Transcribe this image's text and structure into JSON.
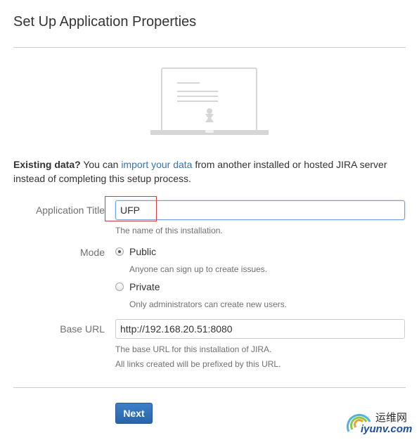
{
  "page": {
    "title": "Set Up Application Properties"
  },
  "existing_data": {
    "bold": "Existing data?",
    "text1": " You can ",
    "link": "import your data",
    "text2": " from another installed or hosted JIRA server instead of completing this setup process."
  },
  "form": {
    "app_title": {
      "label": "Application Title",
      "value": "UFP",
      "description": "The name of this installation."
    },
    "mode": {
      "label": "Mode",
      "options": [
        {
          "label": "Public",
          "description": "Anyone can sign up to create issues.",
          "selected": true
        },
        {
          "label": "Private",
          "description": "Only administrators can create new users.",
          "selected": false
        }
      ]
    },
    "base_url": {
      "label": "Base URL",
      "value": "http://192.168.20.51:8080",
      "description1": "The base URL for this installation of JIRA.",
      "description2": "All links created will be prefixed by this URL."
    }
  },
  "actions": {
    "next_label": "Next"
  },
  "watermark": {
    "cn": "运维网",
    "en": "iyunv.com"
  },
  "colors": {
    "link": "#3b73af",
    "primary_button": "#2d6cb5",
    "highlight": "#d23c3c"
  },
  "icons": {
    "illustration": "laptop-setup-icon",
    "watermark_logo": "watermark-logo-icon"
  }
}
